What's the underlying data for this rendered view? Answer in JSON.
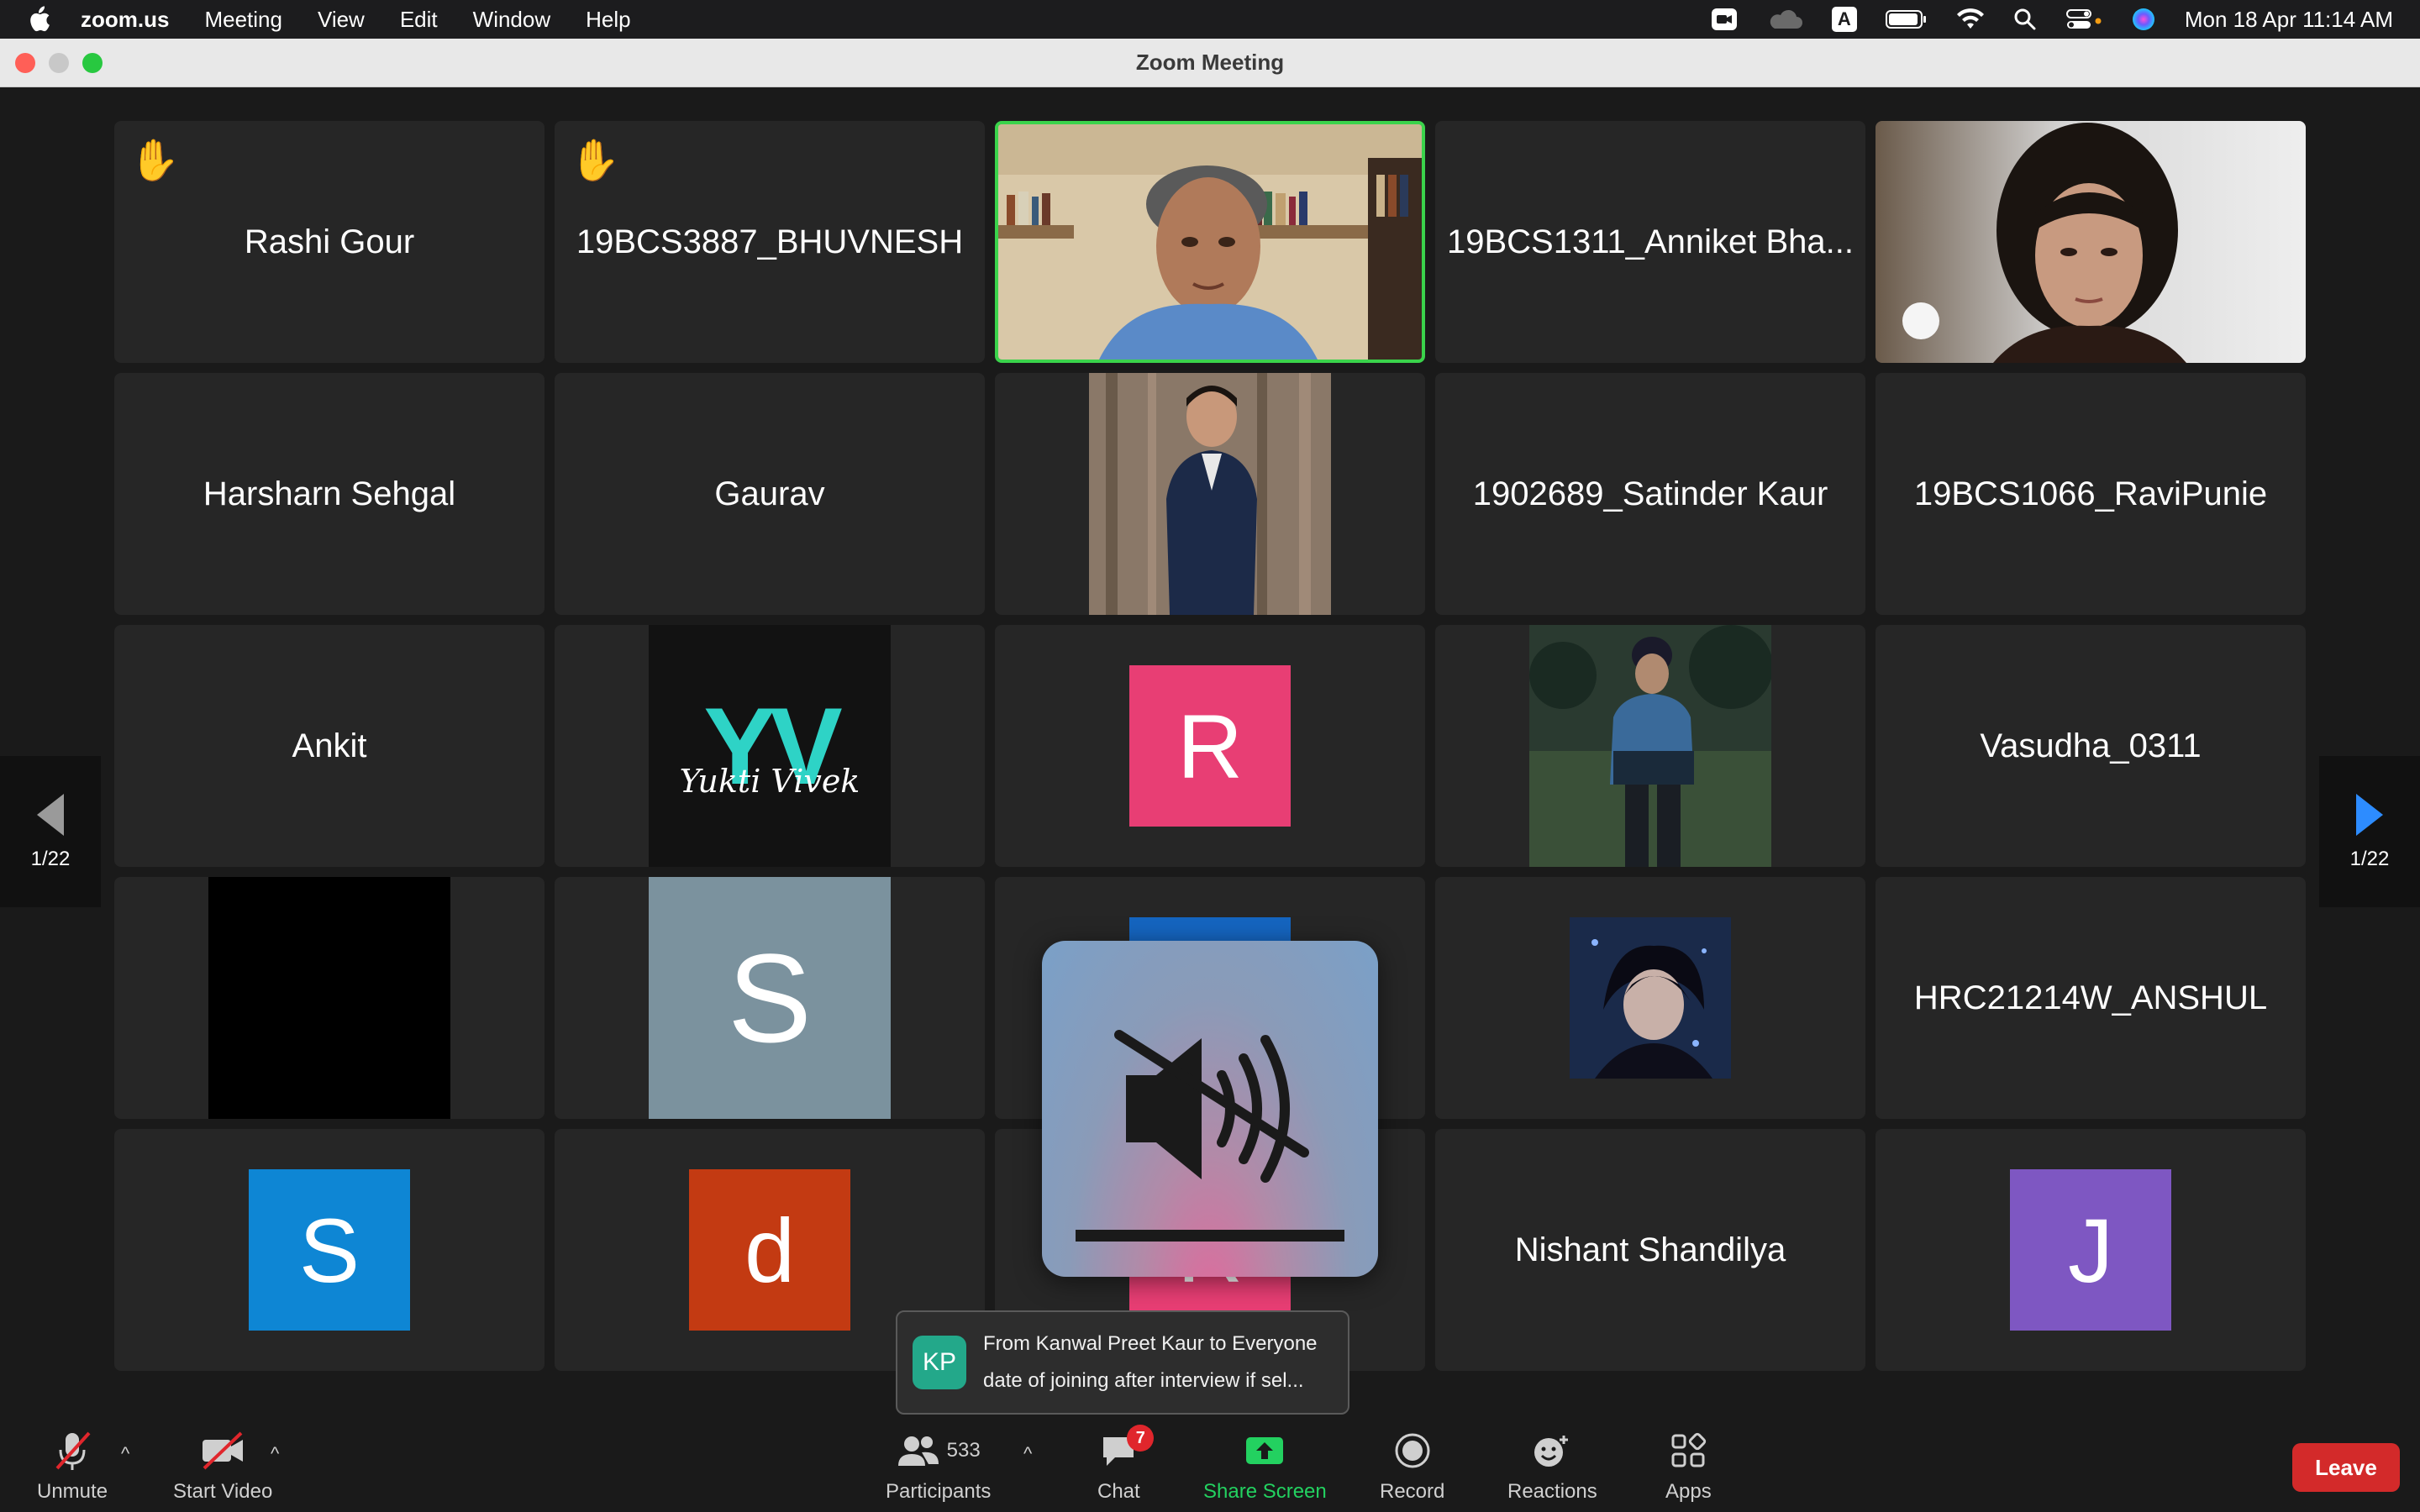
{
  "menubar": {
    "app_name": "zoom.us",
    "menus": [
      "Meeting",
      "View",
      "Edit",
      "Window",
      "Help"
    ],
    "clock": "Mon 18 Apr  11:14 AM",
    "input_indicator": "A"
  },
  "window": {
    "title": "Zoom Meeting"
  },
  "grid": {
    "page_indicator_left": "1/22",
    "page_indicator_right": "1/22",
    "tiles": [
      {
        "name": "Rashi Gour",
        "hand_raised": true
      },
      {
        "name": "19BCS3887_BHUVNESH",
        "hand_raised": true
      },
      {
        "name": "",
        "video": "speaker-video",
        "active_speaker": true
      },
      {
        "name": "19BCS1311_Anniket Bha..."
      },
      {
        "name": "",
        "video": "participant-video-woman"
      },
      {
        "name": "Harsharn Sehgal"
      },
      {
        "name": "Gaurav"
      },
      {
        "name": "",
        "video": "profile-photo-suit"
      },
      {
        "name": "1902689_Satinder Kaur"
      },
      {
        "name": "19BCS1066_RaviPunie"
      },
      {
        "name": "Ankit"
      },
      {
        "name": "",
        "logo_text": "Yukti Vivek",
        "logo_mark": "YV"
      },
      {
        "name": "",
        "avatar_letter": "R",
        "avatar_color": "#e83e74"
      },
      {
        "name": "",
        "video": "profile-photo-night"
      },
      {
        "name": "Vasudha_0311"
      },
      {
        "name": "",
        "video": "black-photo"
      },
      {
        "name": "",
        "avatar_letter": "S",
        "avatar_color": "#7b929e"
      },
      {
        "name": "",
        "partial_avatar_color": "#1565c0"
      },
      {
        "name": "",
        "video": "profile-photo-anime"
      },
      {
        "name": "HRC21214W_ANSHUL"
      },
      {
        "name": "",
        "avatar_letter": "S",
        "avatar_color": "#0e86d4"
      },
      {
        "name": "",
        "avatar_letter": "d",
        "avatar_color": "#c33a12"
      },
      {
        "name": "",
        "avatar_letter": "R",
        "avatar_color": "#e83e74"
      },
      {
        "name": "Nishant Shandilya"
      },
      {
        "name": "",
        "avatar_letter": "J",
        "avatar_color": "#7e57c2"
      }
    ]
  },
  "mute_overlay": {
    "icon": "speaker-muted-icon"
  },
  "chat_toast": {
    "initials": "KP",
    "from_line": "From Kanwal Preet Kaur to Everyone",
    "message": "date of joining after interview if sel..."
  },
  "toolbar": {
    "unmute": "Unmute",
    "start_video": "Start Video",
    "participants": "Participants",
    "participant_count": "533",
    "chat": "Chat",
    "chat_badge": "7",
    "share_screen": "Share Screen",
    "record": "Record",
    "reactions": "Reactions",
    "apps": "Apps",
    "leave": "Leave"
  },
  "colors": {
    "share_green": "#23d160",
    "leave_red": "#d32a2a",
    "active_border": "#3ad34b",
    "nav_arrow_blue": "#2d8cff"
  }
}
